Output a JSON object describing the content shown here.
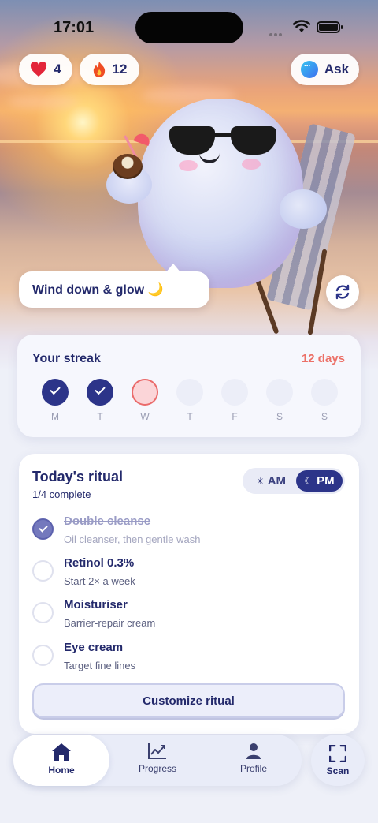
{
  "status_bar": {
    "time": "17:01"
  },
  "header": {
    "hearts": {
      "icon": "heart-icon",
      "count": "4"
    },
    "streak": {
      "icon": "flame-icon",
      "count": "12"
    },
    "ask_button": {
      "icon": "chat-bubble-icon",
      "label": "Ask"
    }
  },
  "mascot": {
    "speech": "Wind down & glow 🌙",
    "refresh_icon": "refresh-icon"
  },
  "streak_card": {
    "title": "Your streak",
    "days_text": "12 days",
    "days": [
      {
        "label": "M",
        "state": "done"
      },
      {
        "label": "T",
        "state": "done"
      },
      {
        "label": "W",
        "state": "today"
      },
      {
        "label": "T",
        "state": "future"
      },
      {
        "label": "F",
        "state": "future"
      },
      {
        "label": "S",
        "state": "future"
      },
      {
        "label": "S",
        "state": "future"
      }
    ]
  },
  "ritual": {
    "title": "Today's ritual",
    "progress": "1/4 complete",
    "toggle": {
      "am_icon": "☀",
      "am_label": "AM",
      "pm_icon": "☾",
      "pm_label": "PM",
      "selected": "PM"
    },
    "tasks": [
      {
        "name": "Double cleanse",
        "desc": "Oil cleanser, then gentle wash",
        "done": true
      },
      {
        "name": "Retinol 0.3%",
        "desc": "Start 2× a week",
        "done": false
      },
      {
        "name": "Moisturiser",
        "desc": "Barrier-repair cream",
        "done": false
      },
      {
        "name": "Eye cream",
        "desc": "Target fine lines",
        "done": false
      }
    ],
    "customize_label": "Customize ritual"
  },
  "nav": {
    "items": [
      {
        "label": "Home",
        "icon": "home-icon",
        "active": true
      },
      {
        "label": "Progress",
        "icon": "chart-icon",
        "active": false
      },
      {
        "label": "Profile",
        "icon": "person-icon",
        "active": false
      }
    ],
    "scan": {
      "label": "Scan",
      "icon": "scan-icon"
    }
  },
  "colors": {
    "primary": "#2c3489",
    "streak_accent": "#ec7067",
    "text": "#23296b"
  }
}
